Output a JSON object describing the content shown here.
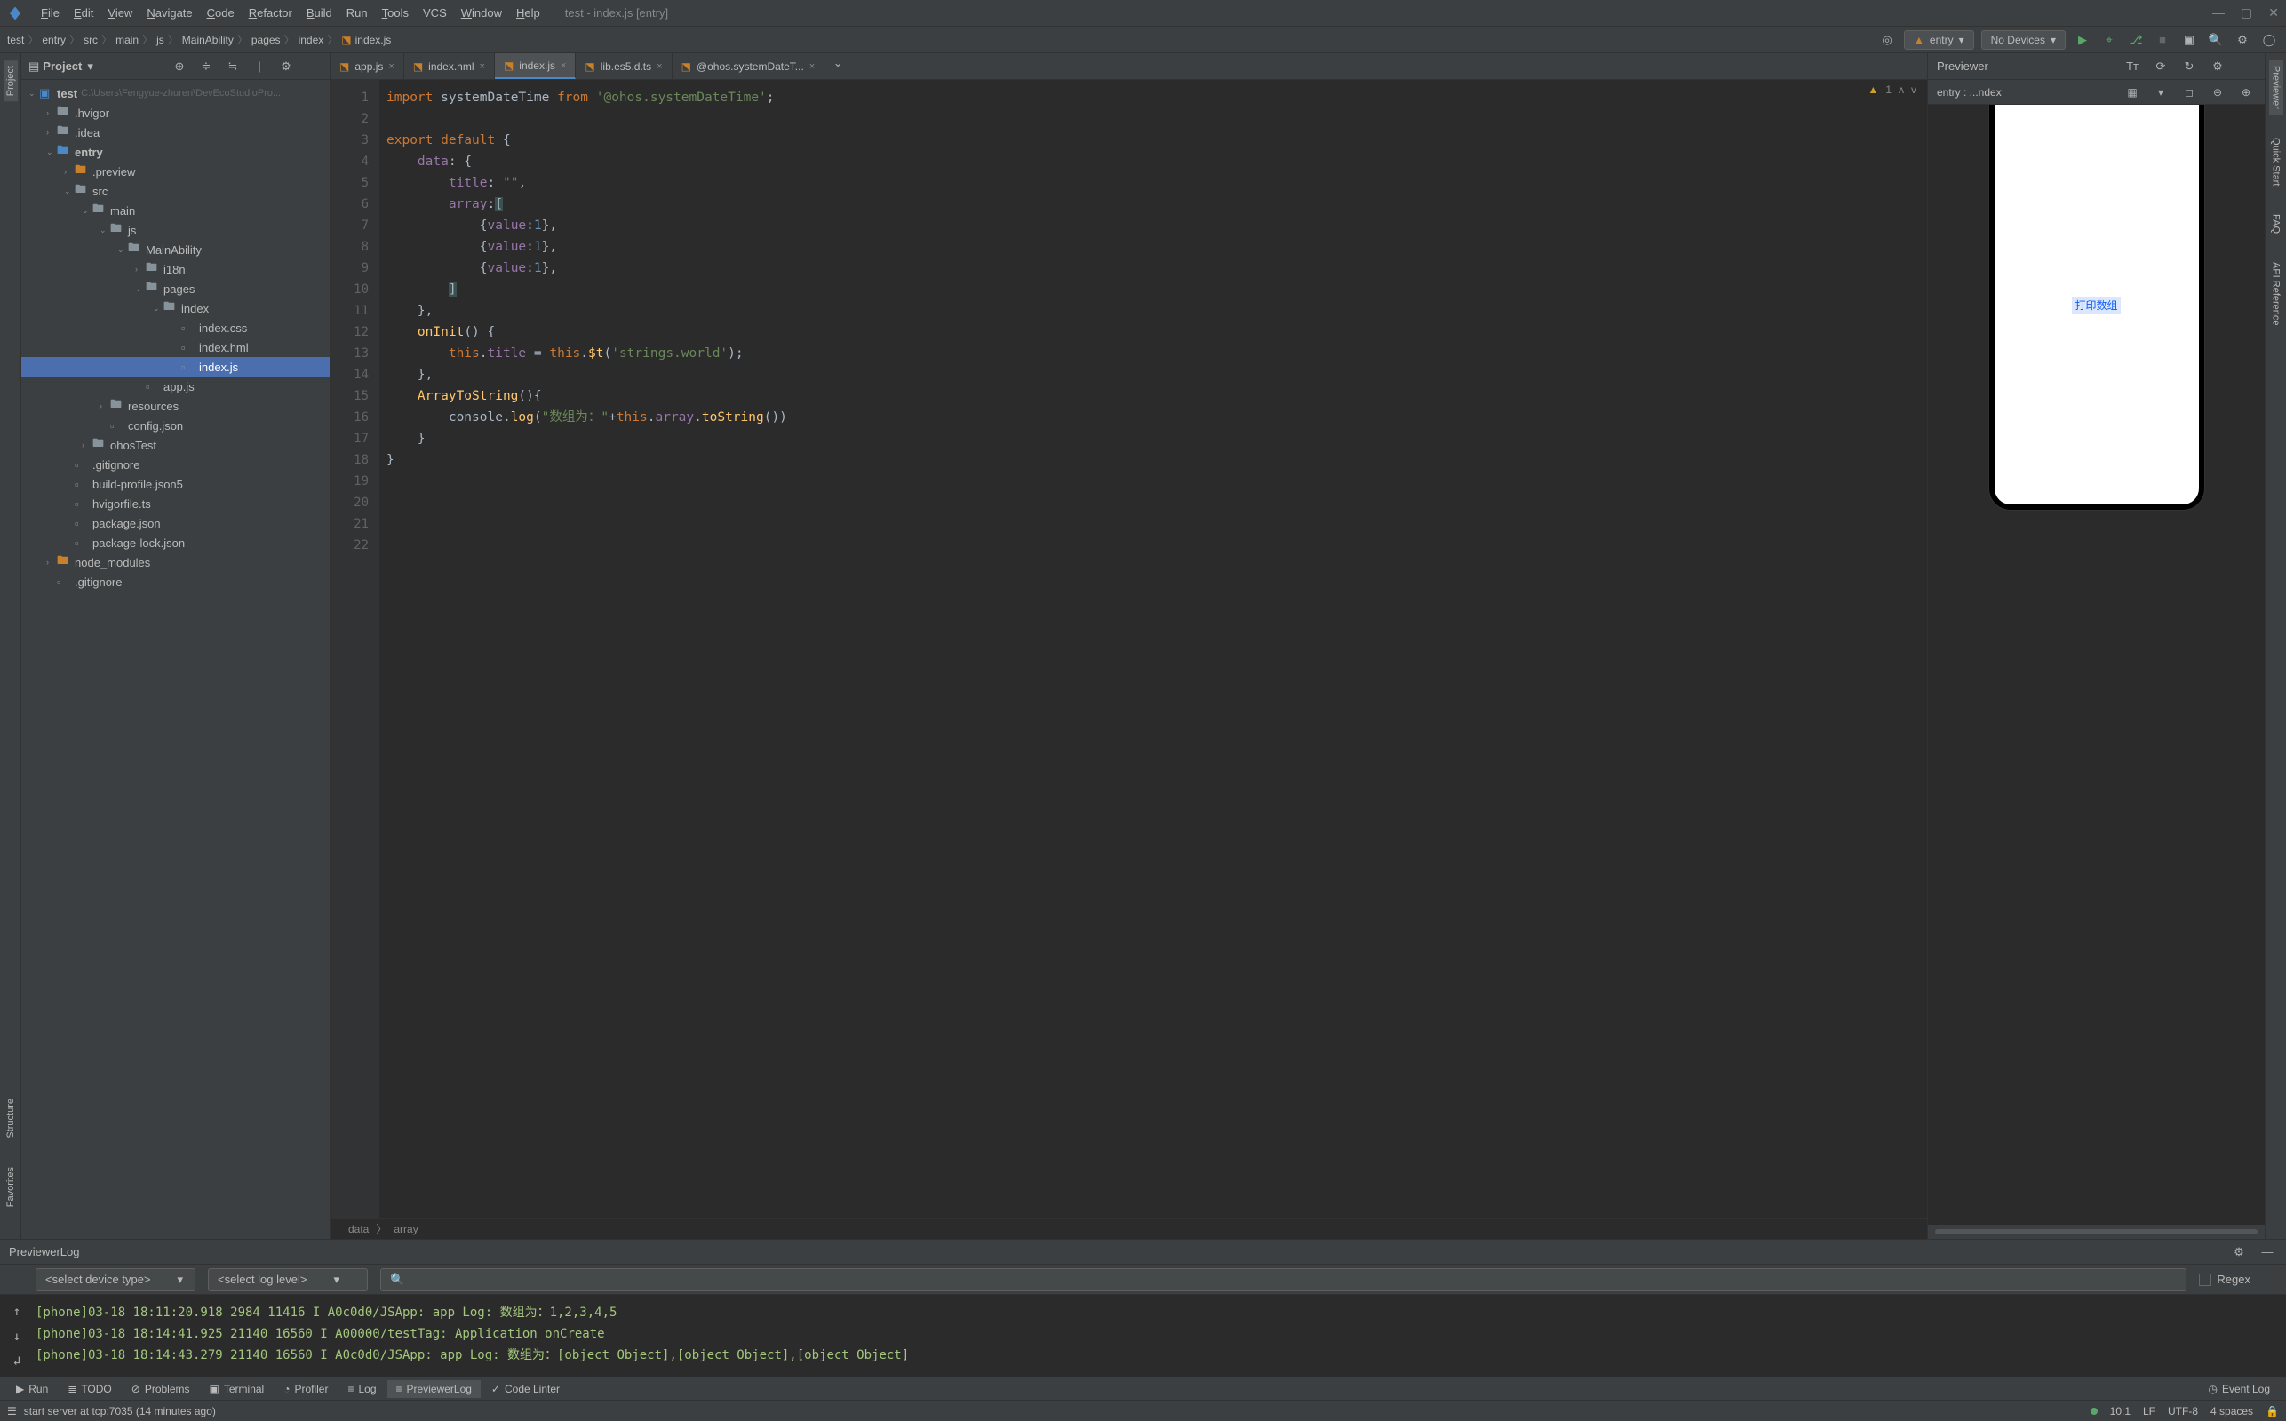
{
  "window": {
    "title": "test - index.js [entry]"
  },
  "menu": [
    "File",
    "Edit",
    "View",
    "Navigate",
    "Code",
    "Refactor",
    "Build",
    "Run",
    "Tools",
    "VCS",
    "Window",
    "Help"
  ],
  "breadcrumb": [
    "test",
    "entry",
    "src",
    "main",
    "js",
    "MainAbility",
    "pages",
    "index",
    "index.js"
  ],
  "toolbar": {
    "config": "entry",
    "devices": "No Devices"
  },
  "project": {
    "title": "Project",
    "root": {
      "name": "test",
      "path": "C:\\Users\\Fengyue-zhuren\\DevEcoStudioPro..."
    },
    "tree": [
      {
        "indent": 1,
        "arrow": "›",
        "icon": "folder",
        "label": ".hvigor"
      },
      {
        "indent": 1,
        "arrow": "›",
        "icon": "folder",
        "label": ".idea"
      },
      {
        "indent": 1,
        "arrow": "⌄",
        "icon": "folder-blue",
        "label": "entry",
        "bold": true
      },
      {
        "indent": 2,
        "arrow": "›",
        "icon": "folder-orange",
        "label": ".preview"
      },
      {
        "indent": 2,
        "arrow": "⌄",
        "icon": "folder",
        "label": "src"
      },
      {
        "indent": 3,
        "arrow": "⌄",
        "icon": "folder",
        "label": "main"
      },
      {
        "indent": 4,
        "arrow": "⌄",
        "icon": "folder",
        "label": "js"
      },
      {
        "indent": 5,
        "arrow": "⌄",
        "icon": "folder",
        "label": "MainAbility"
      },
      {
        "indent": 6,
        "arrow": "›",
        "icon": "folder",
        "label": "i18n"
      },
      {
        "indent": 6,
        "arrow": "⌄",
        "icon": "folder",
        "label": "pages"
      },
      {
        "indent": 7,
        "arrow": "⌄",
        "icon": "folder",
        "label": "index"
      },
      {
        "indent": 8,
        "arrow": "",
        "icon": "css",
        "label": "index.css"
      },
      {
        "indent": 8,
        "arrow": "",
        "icon": "hml",
        "label": "index.hml"
      },
      {
        "indent": 8,
        "arrow": "",
        "icon": "js",
        "label": "index.js",
        "selected": true
      },
      {
        "indent": 6,
        "arrow": "",
        "icon": "js",
        "label": "app.js"
      },
      {
        "indent": 4,
        "arrow": "›",
        "icon": "folder",
        "label": "resources"
      },
      {
        "indent": 4,
        "arrow": "",
        "icon": "json",
        "label": "config.json"
      },
      {
        "indent": 3,
        "arrow": "›",
        "icon": "folder",
        "label": "ohosTest"
      },
      {
        "indent": 2,
        "arrow": "",
        "icon": "file",
        "label": ".gitignore"
      },
      {
        "indent": 2,
        "arrow": "",
        "icon": "json",
        "label": "build-profile.json5"
      },
      {
        "indent": 2,
        "arrow": "",
        "icon": "ts",
        "label": "hvigorfile.ts"
      },
      {
        "indent": 2,
        "arrow": "",
        "icon": "json",
        "label": "package.json"
      },
      {
        "indent": 2,
        "arrow": "",
        "icon": "json",
        "label": "package-lock.json"
      },
      {
        "indent": 1,
        "arrow": "›",
        "icon": "folder-orange",
        "label": "node_modules"
      },
      {
        "indent": 1,
        "arrow": "",
        "icon": "file",
        "label": ".gitignore"
      }
    ]
  },
  "editorTabs": [
    {
      "name": "app.js",
      "icon": "js"
    },
    {
      "name": "index.hml",
      "icon": "hml"
    },
    {
      "name": "index.js",
      "icon": "js",
      "active": true
    },
    {
      "name": "lib.es5.d.ts",
      "icon": "ts"
    },
    {
      "name": "@ohos.systemDateT...",
      "icon": "ts"
    }
  ],
  "code": {
    "lines": [
      "1",
      "2",
      "3",
      "4",
      "5",
      "6",
      "7",
      "8",
      "9",
      "10",
      "11",
      "12",
      "13",
      "14",
      "15",
      "16",
      "17",
      "18",
      "19",
      "20",
      "21",
      "22"
    ],
    "warnings": "1",
    "breadcrumb": [
      "data",
      "array"
    ]
  },
  "previewer": {
    "title": "Previewer",
    "entry": "entry : ...ndex",
    "buttonText": "打印数组"
  },
  "logPanel": {
    "title": "PreviewerLog",
    "deviceSelect": "<select device type>",
    "levelSelect": "<select log level>",
    "searchPlaceholder": "",
    "regexLabel": "Regex",
    "lines": [
      "[phone]03-18 18:11:20.918  2984 11416 I A0c0d0/JSApp: app Log: 数组为：1,2,3,4,5",
      "[phone]03-18 18:14:41.925 21140 16560 I A00000/testTag: Application onCreate",
      "[phone]03-18 18:14:43.279 21140 16560 I A0c0d0/JSApp: app Log: 数组为：[object Object],[object Object],[object Object]"
    ]
  },
  "bottomTabs": [
    "Run",
    "TODO",
    "Problems",
    "Terminal",
    "Profiler",
    "Log",
    "PreviewerLog",
    "Code Linter"
  ],
  "bottomTabActive": "PreviewerLog",
  "eventLog": "Event Log",
  "statusbar": {
    "message": "start server at tcp:7035 (14 minutes ago)",
    "pos": "10:1",
    "lf": "LF",
    "enc": "UTF-8",
    "indent": "4 spaces"
  },
  "leftTabs": [
    "Project"
  ],
  "leftTabsBottom": [
    "Structure",
    "Favorites"
  ],
  "rightTabs": [
    "Previewer",
    "Quick Start",
    "FAQ",
    "API Reference"
  ]
}
